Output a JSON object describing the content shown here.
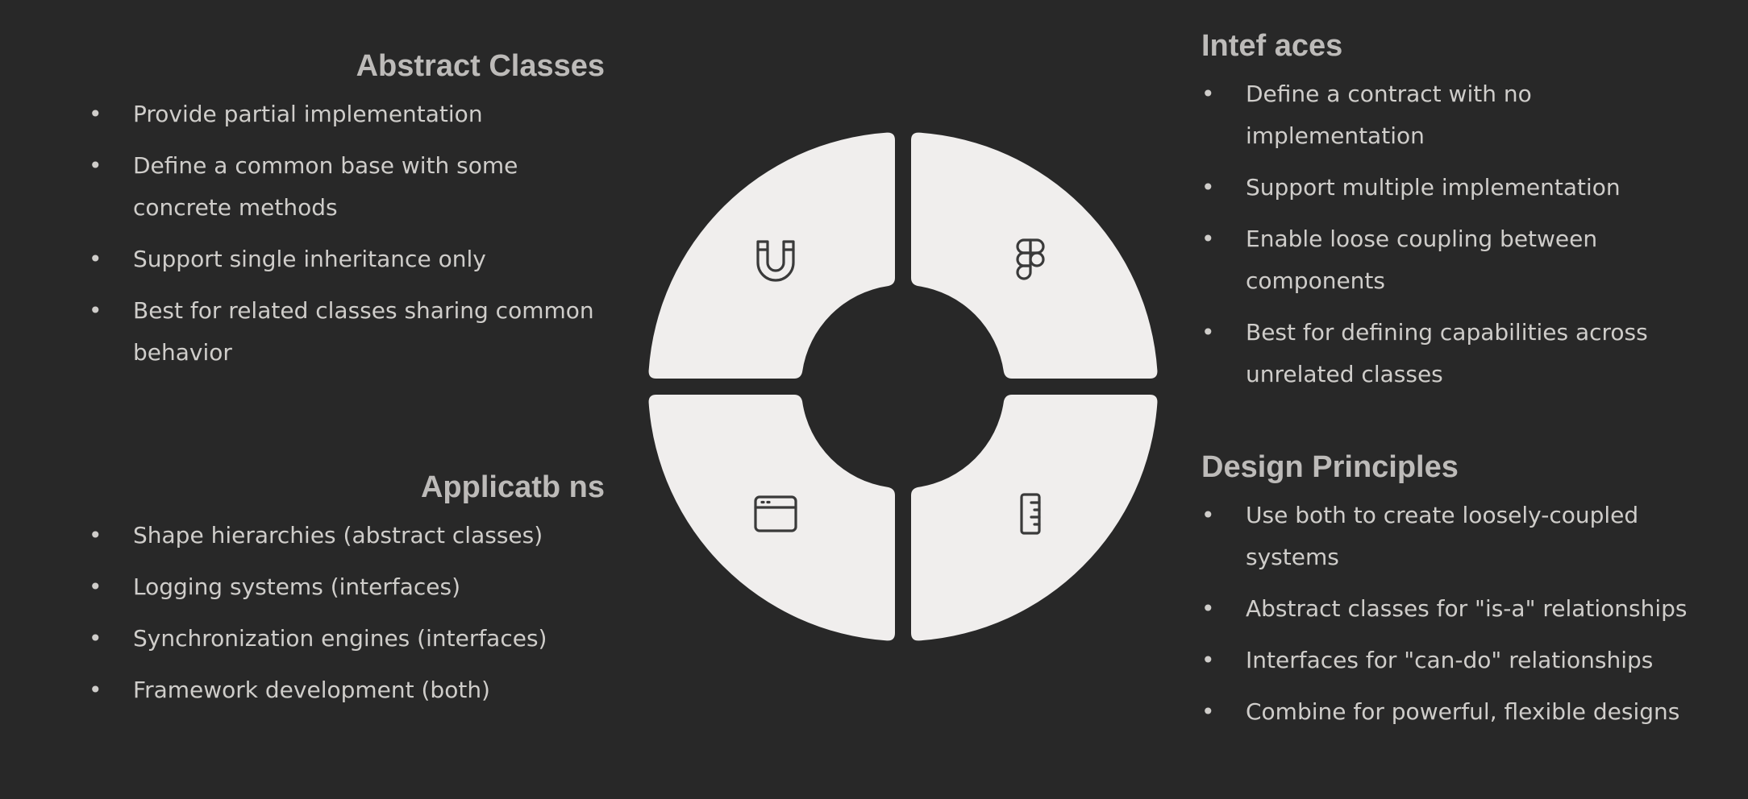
{
  "sections": {
    "abstract": {
      "title": "Abstract Classes",
      "items": [
        "Provide partial implementation",
        "Define a common base with some concrete methods",
        "Support single inheritance only",
        "Best for related classes sharing common behavior"
      ]
    },
    "applications": {
      "title": "Applicatb ns",
      "items": [
        "Shape hierarchies (abstract classes)",
        "Logging systems (interfaces)",
        "Synchronization engines (interfaces)",
        "Framework development (both)"
      ]
    },
    "interfaces": {
      "title": "Intef aces",
      "items": [
        "Define a contract with no implementation",
        "Support multiple implementation",
        "Enable loose coupling between components",
        "Best for defining capabilities across unrelated classes"
      ]
    },
    "design": {
      "title": "Design Principles",
      "items": [
        "Use both to create loosely-coupled systems",
        "Abstract classes for \"is-a\" relationships",
        "Interfaces for \"can-do\" relationships",
        "Combine for powerful, flexible designs"
      ]
    }
  },
  "bullet": "•",
  "diagram": {
    "segment_color": "#f0eeed",
    "icon_color": "#3a3a3a",
    "quadrants": [
      {
        "id": "top-left",
        "icon": "magnet-icon"
      },
      {
        "id": "top-right",
        "icon": "figma-icon"
      },
      {
        "id": "bottom-left",
        "icon": "browser-window-icon"
      },
      {
        "id": "bottom-right",
        "icon": "ruler-icon"
      }
    ]
  }
}
